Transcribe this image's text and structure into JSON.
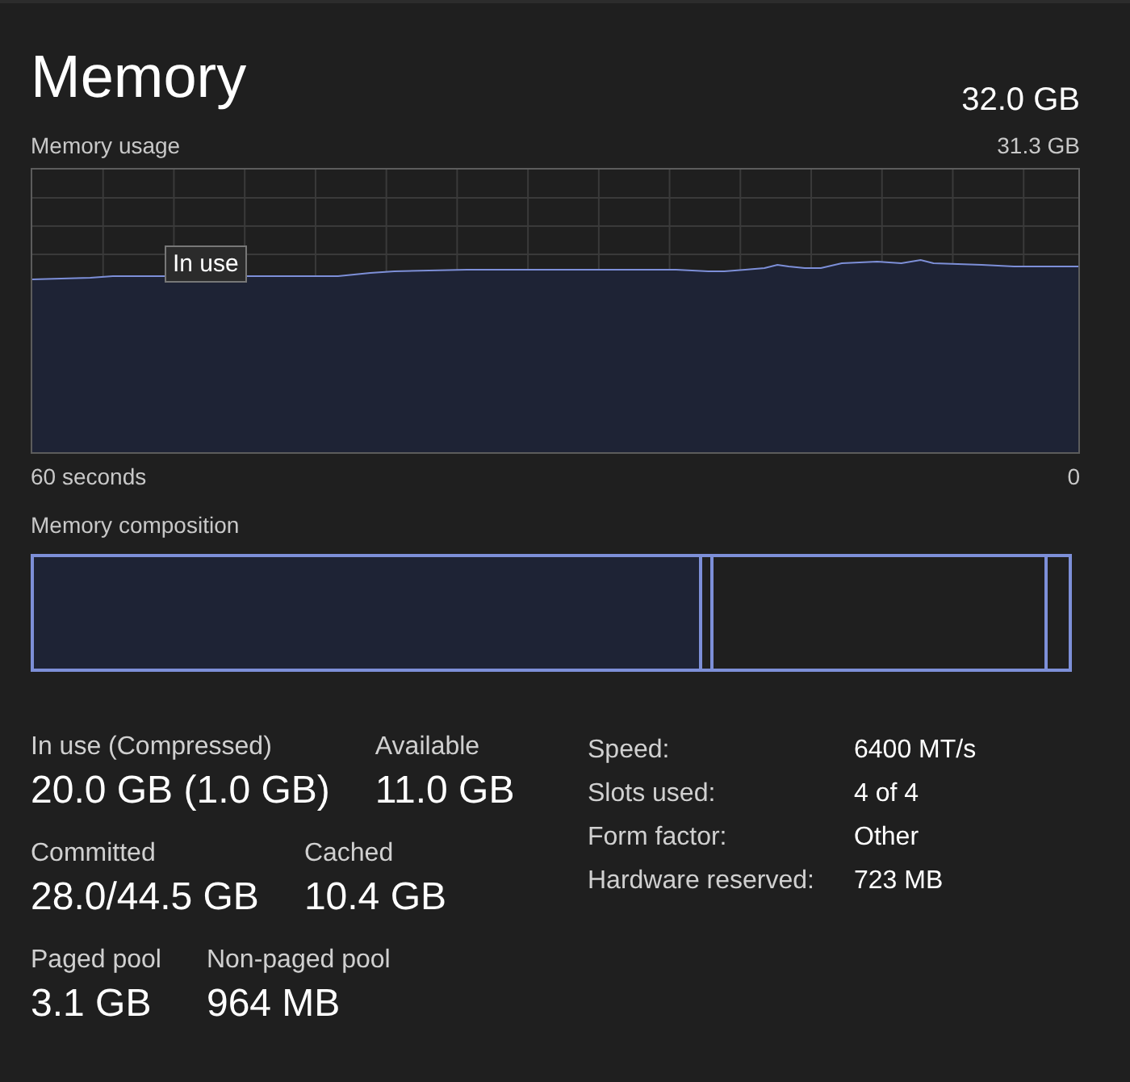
{
  "header": {
    "title": "Memory",
    "total": "32.0 GB"
  },
  "usage_chart": {
    "label": "Memory usage",
    "max": "31.3 GB",
    "tooltip": "In use",
    "left_axis": "60 seconds",
    "right_axis": "0"
  },
  "composition": {
    "label": "Memory composition",
    "segments": [
      {
        "kind": "in-use"
      },
      {
        "kind": "modified"
      },
      {
        "kind": "standby"
      },
      {
        "kind": "free"
      }
    ]
  },
  "stats": [
    [
      {
        "label": "In use (Compressed)",
        "value": "20.0 GB (1.0 GB)"
      },
      {
        "label": "Available",
        "value": "11.0 GB"
      }
    ],
    [
      {
        "label": "Committed",
        "value": "28.0/44.5 GB"
      },
      {
        "label": "Cached",
        "value": "10.4 GB"
      }
    ],
    [
      {
        "label": "Paged pool",
        "value": "3.1 GB"
      },
      {
        "label": "Non-paged pool",
        "value": "964 MB"
      }
    ]
  ],
  "details": [
    {
      "label": "Speed:",
      "value": "6400 MT/s"
    },
    {
      "label": "Slots used:",
      "value": "4 of 4"
    },
    {
      "label": "Form factor:",
      "value": "Other"
    },
    {
      "label": "Hardware reserved:",
      "value": "723 MB"
    }
  ]
}
